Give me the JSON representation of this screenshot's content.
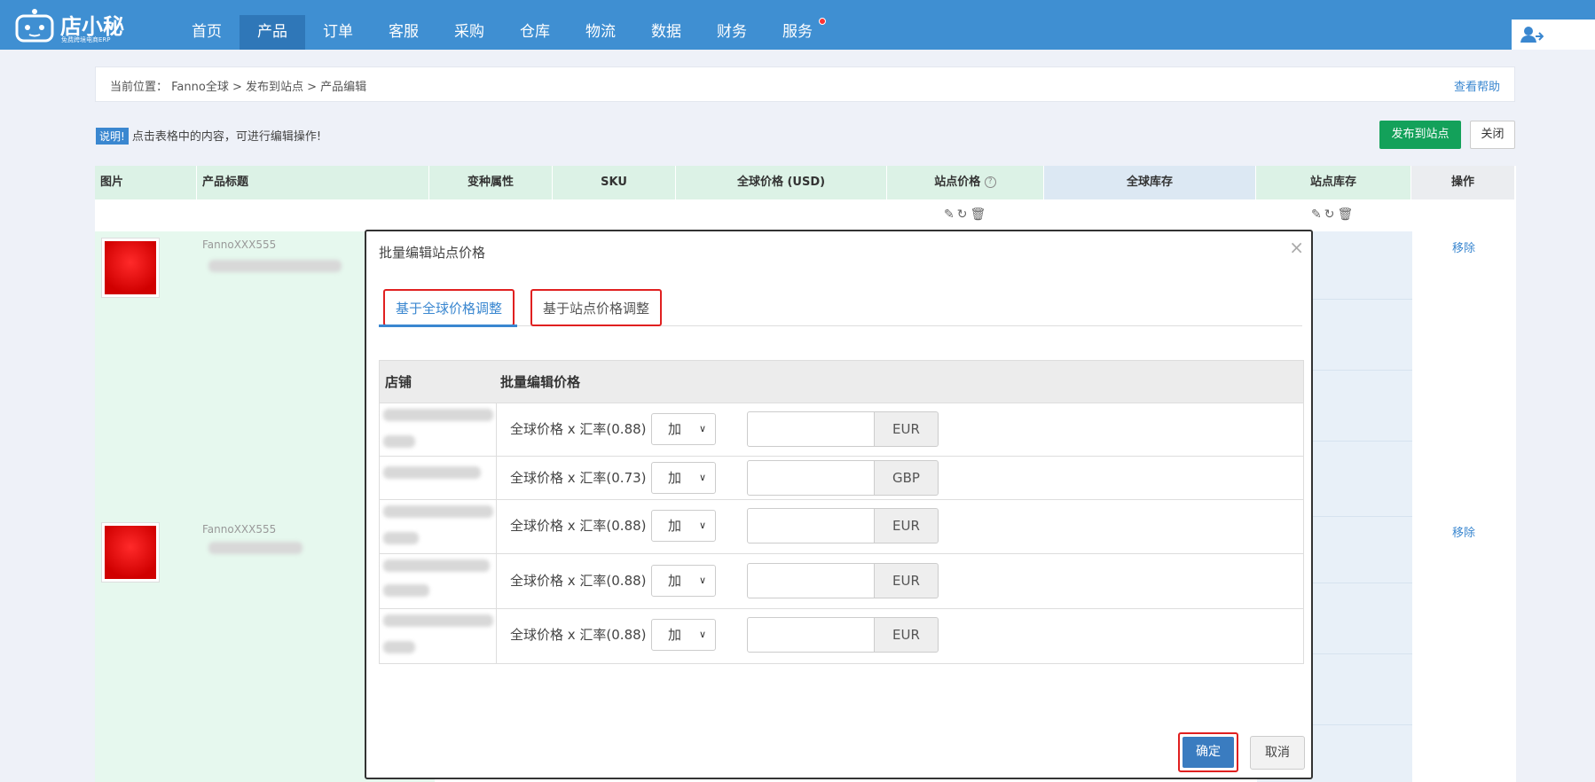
{
  "header": {
    "logo_name": "店小秘",
    "logo_sub": "免费跨境电商ERP",
    "nav": [
      "首页",
      "产品",
      "订单",
      "客服",
      "采购",
      "仓库",
      "物流",
      "数据",
      "财务",
      "服务"
    ],
    "active_nav": "产品"
  },
  "breadcrumb": {
    "text": "当前位置：  Fanno全球 > 发布到站点 > 产品编辑",
    "help": "查看帮助"
  },
  "note": {
    "badge": "说明!",
    "text": "点击表格中的内容，可进行编辑操作!"
  },
  "actions": {
    "publish": "发布到站点",
    "close": "关闭"
  },
  "table": {
    "headers": [
      "图片",
      "产品标题",
      "变种属性",
      "SKU",
      "全球价格 (USD)",
      "站点价格",
      "全球库存",
      "站点库存",
      "操作"
    ],
    "products": [
      {
        "title": "FannoXXX555",
        "action": "移除"
      },
      {
        "title": "FannoXXX555",
        "action": "移除"
      }
    ]
  },
  "modal": {
    "title": "批量编辑站点价格",
    "tabs": [
      "基于全球价格调整",
      "基于站点价格调整"
    ],
    "columns": [
      "店铺",
      "批量编辑价格"
    ],
    "rows": [
      {
        "formula": "全球价格 x 汇率(0.88)",
        "op": "加",
        "currency": "EUR"
      },
      {
        "formula": "全球价格 x 汇率(0.73)",
        "op": "加",
        "currency": "GBP"
      },
      {
        "formula": "全球价格 x 汇率(0.88)",
        "op": "加",
        "currency": "EUR"
      },
      {
        "formula": "全球价格 x 汇率(0.88)",
        "op": "加",
        "currency": "EUR"
      },
      {
        "formula": "全球价格 x 汇率(0.88)",
        "op": "加",
        "currency": "EUR"
      }
    ],
    "ok": "确定",
    "cancel": "取消"
  },
  "colors": {
    "topbar": "#3f8fd2",
    "accent": "#3a87d0",
    "publish": "#13a15a",
    "highlight": "#e02020"
  }
}
